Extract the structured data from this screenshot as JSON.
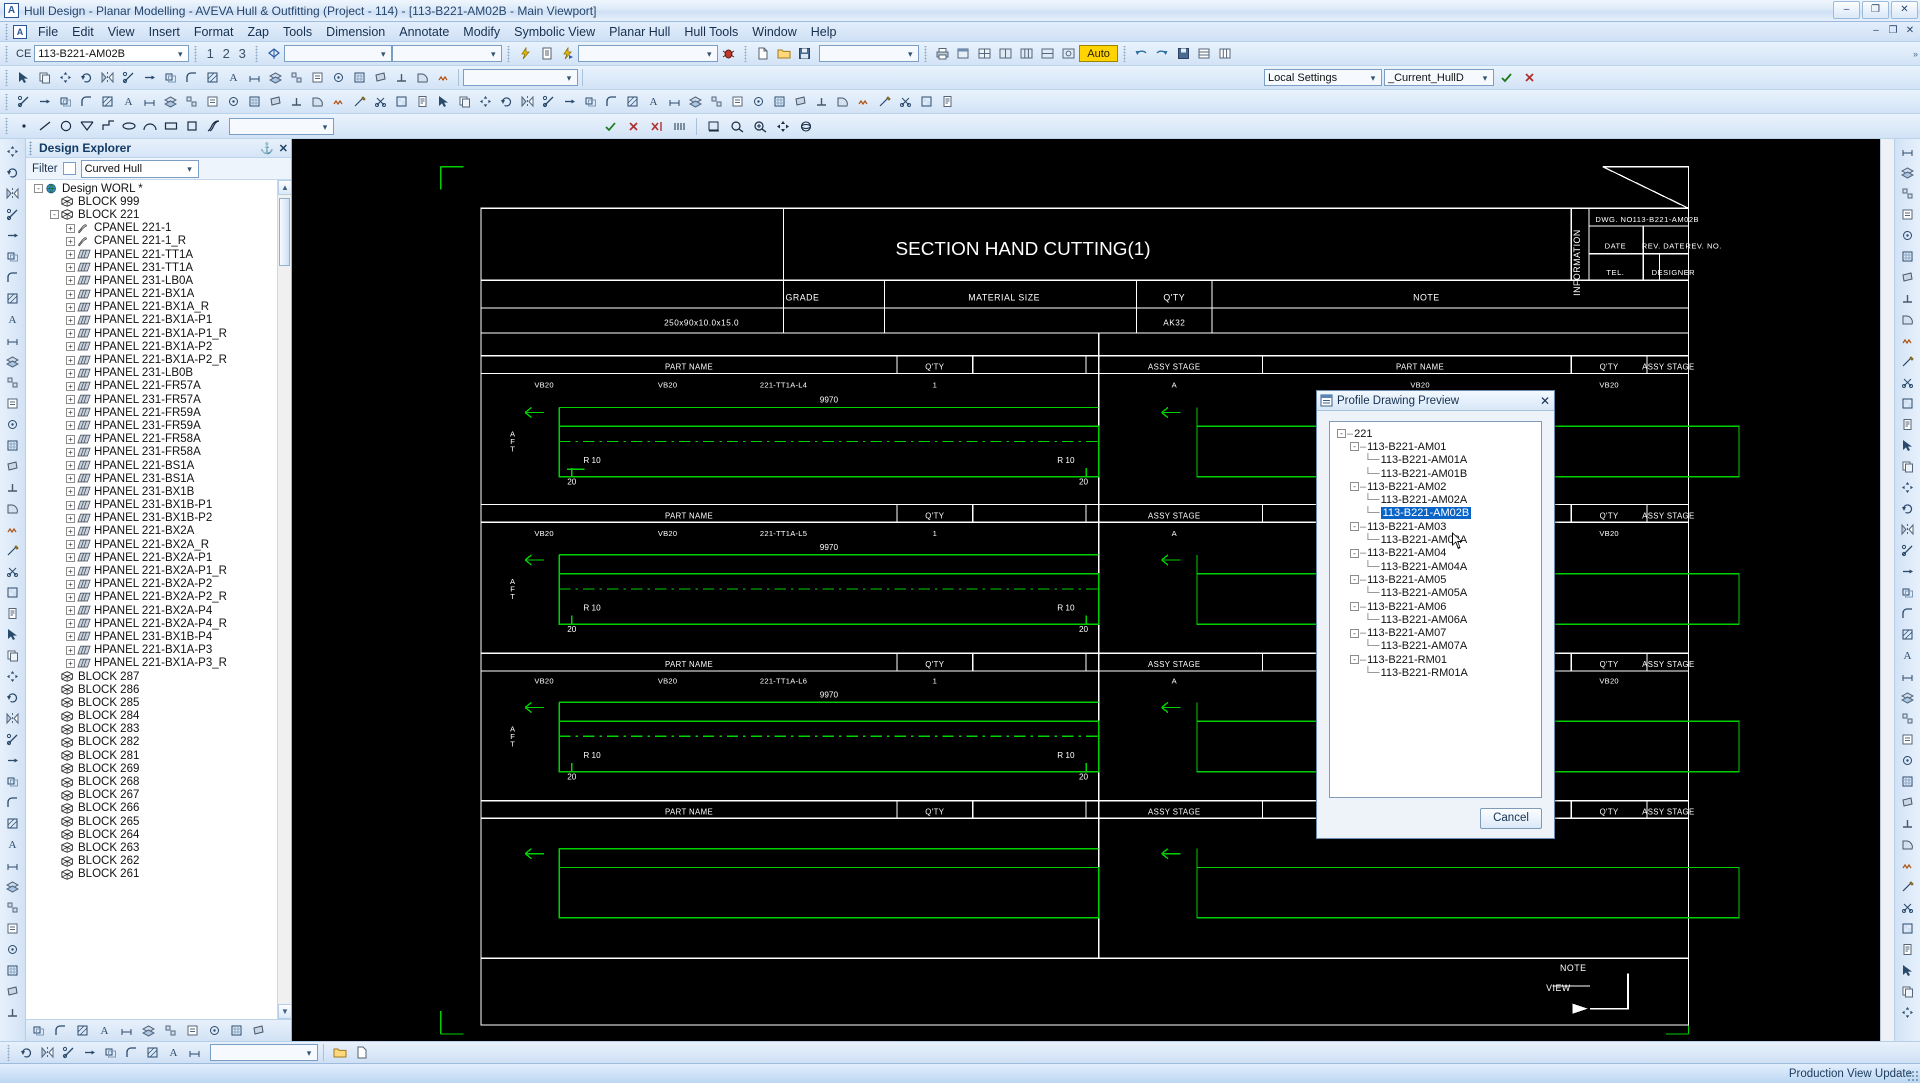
{
  "window": {
    "title": "Hull Design - Planar Modelling -  AVEVA Hull & Outfitting (Project - 114) - [113-B221-AM02B - Main Viewport]",
    "app_icon": "A",
    "minimize": "–",
    "maximize": "❐",
    "close": "✕"
  },
  "menubar": {
    "items": [
      "File",
      "Edit",
      "View",
      "Insert",
      "Format",
      "Zap",
      "Tools",
      "Dimension",
      "Annotate",
      "Modify",
      "Symbolic View",
      "Planar Hull",
      "Hull Tools",
      "Window",
      "Help"
    ],
    "right_buttons": [
      "–",
      "❐",
      "✕"
    ]
  },
  "toolbar_row1": {
    "ce_label": "CE",
    "ce_value": "113-B221-AM02B",
    "numbers": [
      "1",
      "2",
      "3"
    ],
    "combo1": "",
    "combo2": "",
    "combo3": "",
    "combo4": "",
    "auto_label": "Auto"
  },
  "toolbar_row3": {
    "local_settings": "Local Settings",
    "current_hull": "_Current_HullD"
  },
  "explorer": {
    "header": "Design Explorer",
    "pin_icon": "⚓",
    "close_icon": "✕",
    "filter_label": "Filter",
    "filter_value": "Curved Hull",
    "root": "Design WORL *",
    "items": [
      {
        "label": "BLOCK 999",
        "level": 1,
        "icon": "block",
        "expander": ""
      },
      {
        "label": "BLOCK 221",
        "level": 1,
        "icon": "block",
        "expander": "-"
      },
      {
        "label": "CPANEL 221-1",
        "level": 2,
        "icon": "cpanel",
        "expander": "+"
      },
      {
        "label": "CPANEL 221-1_R",
        "level": 2,
        "icon": "cpanel",
        "expander": "+"
      },
      {
        "label": "HPANEL 221-TT1A",
        "level": 2,
        "icon": "hpanel",
        "expander": "+"
      },
      {
        "label": "HPANEL 231-TT1A",
        "level": 2,
        "icon": "hpanel",
        "expander": "+"
      },
      {
        "label": "HPANEL 231-LB0A",
        "level": 2,
        "icon": "hpanel",
        "expander": "+"
      },
      {
        "label": "HPANEL 221-BX1A",
        "level": 2,
        "icon": "hpanel",
        "expander": "+"
      },
      {
        "label": "HPANEL 221-BX1A_R",
        "level": 2,
        "icon": "hpanel",
        "expander": "+"
      },
      {
        "label": "HPANEL 221-BX1A-P1",
        "level": 2,
        "icon": "hpanel",
        "expander": "+"
      },
      {
        "label": "HPANEL 221-BX1A-P1_R",
        "level": 2,
        "icon": "hpanel",
        "expander": "+"
      },
      {
        "label": "HPANEL 221-BX1A-P2",
        "level": 2,
        "icon": "hpanel",
        "expander": "+"
      },
      {
        "label": "HPANEL 221-BX1A-P2_R",
        "level": 2,
        "icon": "hpanel",
        "expander": "+"
      },
      {
        "label": "HPANEL 231-LB0B",
        "level": 2,
        "icon": "hpanel",
        "expander": "+"
      },
      {
        "label": "HPANEL 221-FR57A",
        "level": 2,
        "icon": "hpanel",
        "expander": "+"
      },
      {
        "label": "HPANEL 231-FR57A",
        "level": 2,
        "icon": "hpanel",
        "expander": "+"
      },
      {
        "label": "HPANEL 221-FR59A",
        "level": 2,
        "icon": "hpanel",
        "expander": "+"
      },
      {
        "label": "HPANEL 231-FR59A",
        "level": 2,
        "icon": "hpanel",
        "expander": "+"
      },
      {
        "label": "HPANEL 221-FR58A",
        "level": 2,
        "icon": "hpanel",
        "expander": "+"
      },
      {
        "label": "HPANEL 231-FR58A",
        "level": 2,
        "icon": "hpanel",
        "expander": "+"
      },
      {
        "label": "HPANEL 221-BS1A",
        "level": 2,
        "icon": "hpanel",
        "expander": "+"
      },
      {
        "label": "HPANEL 231-BS1A",
        "level": 2,
        "icon": "hpanel",
        "expander": "+"
      },
      {
        "label": "HPANEL 231-BX1B",
        "level": 2,
        "icon": "hpanel",
        "expander": "+"
      },
      {
        "label": "HPANEL 231-BX1B-P1",
        "level": 2,
        "icon": "hpanel",
        "expander": "+"
      },
      {
        "label": "HPANEL 231-BX1B-P2",
        "level": 2,
        "icon": "hpanel",
        "expander": "+"
      },
      {
        "label": "HPANEL 221-BX2A",
        "level": 2,
        "icon": "hpanel",
        "expander": "+"
      },
      {
        "label": "HPANEL 221-BX2A_R",
        "level": 2,
        "icon": "hpanel",
        "expander": "+"
      },
      {
        "label": "HPANEL 221-BX2A-P1",
        "level": 2,
        "icon": "hpanel",
        "expander": "+"
      },
      {
        "label": "HPANEL 221-BX2A-P1_R",
        "level": 2,
        "icon": "hpanel",
        "expander": "+"
      },
      {
        "label": "HPANEL 221-BX2A-P2",
        "level": 2,
        "icon": "hpanel",
        "expander": "+"
      },
      {
        "label": "HPANEL 221-BX2A-P2_R",
        "level": 2,
        "icon": "hpanel",
        "expander": "+"
      },
      {
        "label": "HPANEL 221-BX2A-P4",
        "level": 2,
        "icon": "hpanel",
        "expander": "+"
      },
      {
        "label": "HPANEL 221-BX2A-P4_R",
        "level": 2,
        "icon": "hpanel",
        "expander": "+"
      },
      {
        "label": "HPANEL 231-BX1B-P4",
        "level": 2,
        "icon": "hpanel",
        "expander": "+"
      },
      {
        "label": "HPANEL 221-BX1A-P3",
        "level": 2,
        "icon": "hpanel",
        "expander": "+"
      },
      {
        "label": "HPANEL 221-BX1A-P3_R",
        "level": 2,
        "icon": "hpanel",
        "expander": "+"
      },
      {
        "label": "BLOCK 287",
        "level": 1,
        "icon": "block",
        "expander": ""
      },
      {
        "label": "BLOCK 286",
        "level": 1,
        "icon": "block",
        "expander": ""
      },
      {
        "label": "BLOCK 285",
        "level": 1,
        "icon": "block",
        "expander": ""
      },
      {
        "label": "BLOCK 284",
        "level": 1,
        "icon": "block",
        "expander": ""
      },
      {
        "label": "BLOCK 283",
        "level": 1,
        "icon": "block",
        "expander": ""
      },
      {
        "label": "BLOCK 282",
        "level": 1,
        "icon": "block",
        "expander": ""
      },
      {
        "label": "BLOCK 281",
        "level": 1,
        "icon": "block",
        "expander": ""
      },
      {
        "label": "BLOCK 269",
        "level": 1,
        "icon": "block",
        "expander": ""
      },
      {
        "label": "BLOCK 268",
        "level": 1,
        "icon": "block",
        "expander": ""
      },
      {
        "label": "BLOCK 267",
        "level": 1,
        "icon": "block",
        "expander": ""
      },
      {
        "label": "BLOCK 266",
        "level": 1,
        "icon": "block",
        "expander": ""
      },
      {
        "label": "BLOCK 265",
        "level": 1,
        "icon": "block",
        "expander": ""
      },
      {
        "label": "BLOCK 264",
        "level": 1,
        "icon": "block",
        "expander": ""
      },
      {
        "label": "BLOCK 263",
        "level": 1,
        "icon": "block",
        "expander": ""
      },
      {
        "label": "BLOCK 262",
        "level": 1,
        "icon": "block",
        "expander": ""
      },
      {
        "label": "BLOCK 261",
        "level": 1,
        "icon": "block",
        "expander": ""
      }
    ]
  },
  "dialog": {
    "title": "Profile Drawing Preview",
    "close_icon": "✕",
    "cancel_label": "Cancel",
    "tree": [
      {
        "label": "221",
        "level": 0,
        "expander": "-",
        "selected": false
      },
      {
        "label": "113-B221-AM01",
        "level": 1,
        "expander": "-",
        "selected": false
      },
      {
        "label": "113-B221-AM01A",
        "level": 2,
        "expander": "",
        "selected": false
      },
      {
        "label": "113-B221-AM01B",
        "level": 2,
        "expander": "",
        "selected": false
      },
      {
        "label": "113-B221-AM02",
        "level": 1,
        "expander": "-",
        "selected": false
      },
      {
        "label": "113-B221-AM02A",
        "level": 2,
        "expander": "",
        "selected": false
      },
      {
        "label": "113-B221-AM02B",
        "level": 2,
        "expander": "",
        "selected": true
      },
      {
        "label": "113-B221-AM03",
        "level": 1,
        "expander": "-",
        "selected": false
      },
      {
        "label": "113-B221-AM03A",
        "level": 2,
        "expander": "",
        "selected": false
      },
      {
        "label": "113-B221-AM04",
        "level": 1,
        "expander": "-",
        "selected": false
      },
      {
        "label": "113-B221-AM04A",
        "level": 2,
        "expander": "",
        "selected": false
      },
      {
        "label": "113-B221-AM05",
        "level": 1,
        "expander": "-",
        "selected": false
      },
      {
        "label": "113-B221-AM05A",
        "level": 2,
        "expander": "",
        "selected": false
      },
      {
        "label": "113-B221-AM06",
        "level": 1,
        "expander": "-",
        "selected": false
      },
      {
        "label": "113-B221-AM06A",
        "level": 2,
        "expander": "",
        "selected": false
      },
      {
        "label": "113-B221-AM07",
        "level": 1,
        "expander": "-",
        "selected": false
      },
      {
        "label": "113-B221-AM07A",
        "level": 2,
        "expander": "",
        "selected": false
      },
      {
        "label": "113-B221-RM01",
        "level": 1,
        "expander": "-",
        "selected": false
      },
      {
        "label": "113-B221-RM01A",
        "level": 2,
        "expander": "",
        "selected": false
      }
    ]
  },
  "drawing": {
    "sheet_title": "SECTION HAND CUTTING(1)",
    "info_label": "INFORMATION",
    "header_fields": [
      {
        "label": "DWG. NO.",
        "value": "113-B221-AM02B"
      },
      {
        "label": "DATE",
        "value": ""
      },
      {
        "label": "REV. DATE",
        "value": ""
      },
      {
        "label": "REV. NO.",
        "value": ""
      },
      {
        "label": "TEL.",
        "value": ""
      },
      {
        "label": "DESIGNER",
        "value": ""
      }
    ],
    "material_headers": [
      "GRADE",
      "MATERIAL SIZE",
      "Q'TY",
      "NOTE"
    ],
    "material_values": [
      "",
      "250x90x10.0x15.0",
      "AK32",
      ""
    ],
    "part_headers": [
      "PART NAME",
      "Q'TY",
      "ASSY STAGE"
    ],
    "rows": [
      {
        "part_name": "221-TT1A-L4",
        "qty": "1",
        "assy_stage": "A",
        "length": "9970",
        "left_tag": "VB20",
        "mid_tag": "VB20",
        "right_tag": "VB20",
        "radius_left": "R 10",
        "radius_right": "R 10",
        "chamfer_left": "20",
        "chamfer_right": "20",
        "direction": "A F T"
      },
      {
        "part_name": "221-TT1A-L5",
        "qty": "1",
        "assy_stage": "A",
        "length": "9970",
        "left_tag": "VB20",
        "mid_tag": "VB20",
        "right_tag": "VB20",
        "radius_left": "R 10",
        "radius_right": "R 10",
        "chamfer_left": "20",
        "chamfer_right": "20",
        "direction": "A F T"
      },
      {
        "part_name": "221-TT1A-L6",
        "qty": "1",
        "assy_stage": "A",
        "length": "9970",
        "left_tag": "VB20",
        "mid_tag": "VB20",
        "right_tag": "VB20",
        "radius_left": "R 10",
        "radius_right": "R 10",
        "chamfer_left": "20",
        "chamfer_right": "20",
        "direction": "A F T"
      }
    ],
    "note_label": "NOTE",
    "view_label": "VIEW",
    "colors": {
      "frame": "#ffffff",
      "geometry": "#00d000",
      "arrow": "#00d000",
      "text": "#ffffff"
    }
  },
  "statusbar": {
    "right_text": "Production View  Update"
  }
}
